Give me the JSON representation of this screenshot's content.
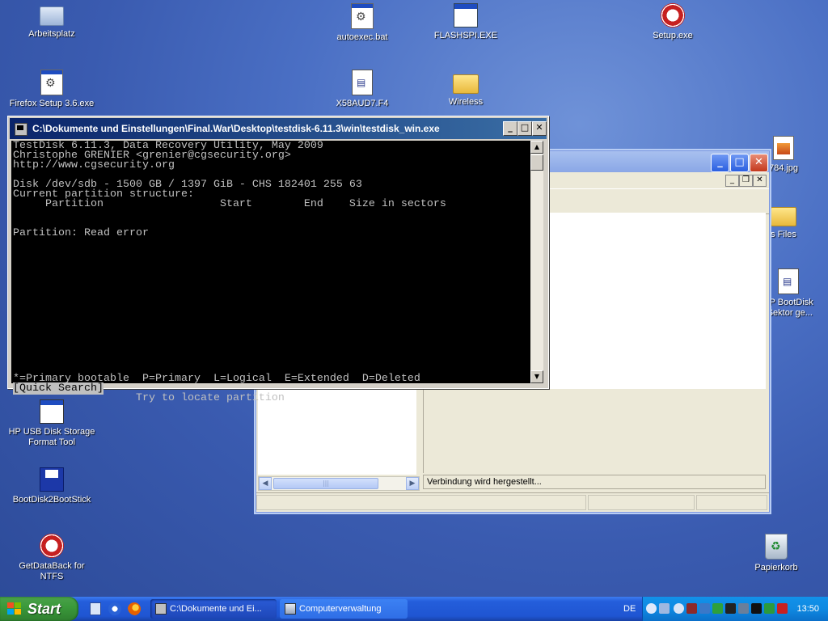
{
  "desktop": {
    "icons": [
      {
        "label": "Arbeitsplatz"
      },
      {
        "label": "autoexec.bat"
      },
      {
        "label": "FLASHSPI.EXE"
      },
      {
        "label": "Setup.exe"
      },
      {
        "label": "Firefox Setup 3.6.exe"
      },
      {
        "label": "X58AUD7.F4"
      },
      {
        "label": "Wireless"
      },
      {
        "label": "784.jpg"
      },
      {
        "label": "s Files"
      },
      {
        "label": "XP BootDisk (Sektor ge..."
      },
      {
        "label": "HP USB Disk Storage Format Tool"
      },
      {
        "label": "BootDisk2BootStick"
      },
      {
        "label": "GetDataBack for NTFS"
      },
      {
        "label": "Papierkorb"
      }
    ]
  },
  "console": {
    "title": "C:\\Dokumente und Einstellungen\\Final.War\\Desktop\\testdisk-6.11.3\\win\\testdisk_win.exe",
    "lines": [
      "TestDisk 6.11.3, Data Recovery Utility, May 2009",
      "Christophe GRENIER <grenier@cgsecurity.org>",
      "http://www.cgsecurity.org",
      "",
      "Disk /dev/sdb - 1500 GB / 1397 GiB - CHS 182401 255 63",
      "Current partition structure:",
      "     Partition                  Start        End    Size in sectors",
      "",
      "",
      "Partition: Read error"
    ],
    "legend": "*=Primary bootable  P=Primary  L=Logical  E=Extended  D=Deleted",
    "menu_selected": "[Quick Search]",
    "menu_hint": "Try to locate partition"
  },
  "background_window": {
    "status_text": "Verbindung wird hergestellt..."
  },
  "taskbar": {
    "start_label": "Start",
    "tasks": [
      {
        "label": "C:\\Dokumente und Ei..."
      },
      {
        "label": "Computerverwaltung"
      }
    ],
    "language": "DE",
    "clock": "13:50"
  }
}
